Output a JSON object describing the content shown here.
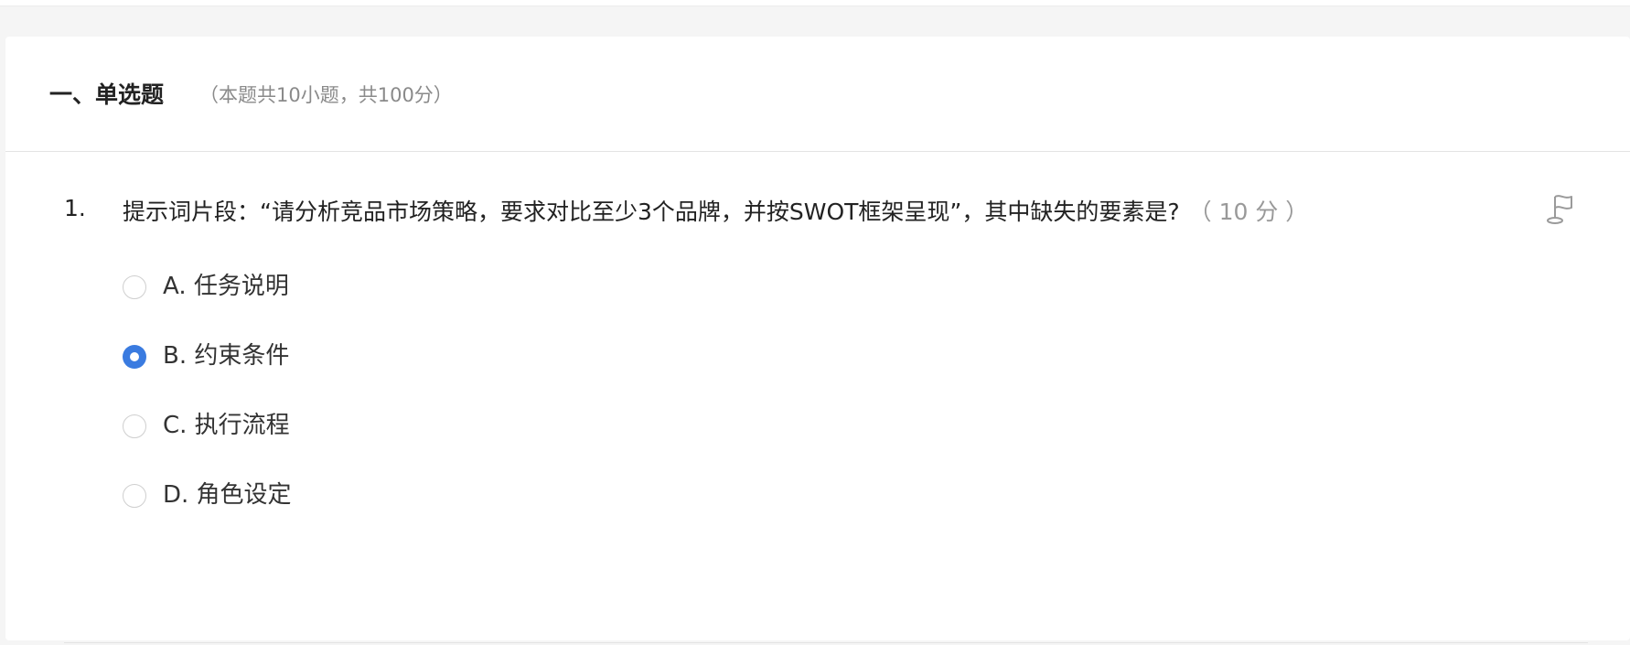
{
  "section": {
    "title": "一、单选题",
    "meta": "（本题共10小题，共100分）"
  },
  "question": {
    "number": "1.",
    "stem": "提示词片段：“请分析竞品市场策略，要求对比至少3个品牌，并按SWOT框架呈现”，其中缺失的要素是?",
    "score": "（ 10 分 ）",
    "flag_icon": "flag-icon",
    "options": [
      {
        "label": "A. 任务说明",
        "selected": false
      },
      {
        "label": "B. 约束条件",
        "selected": true
      },
      {
        "label": "C. 执行流程",
        "selected": false
      },
      {
        "label": "D. 角色设定",
        "selected": false
      }
    ]
  },
  "colors": {
    "accent": "#3a7be0",
    "text": "#222222",
    "muted": "#8a8a8a"
  }
}
